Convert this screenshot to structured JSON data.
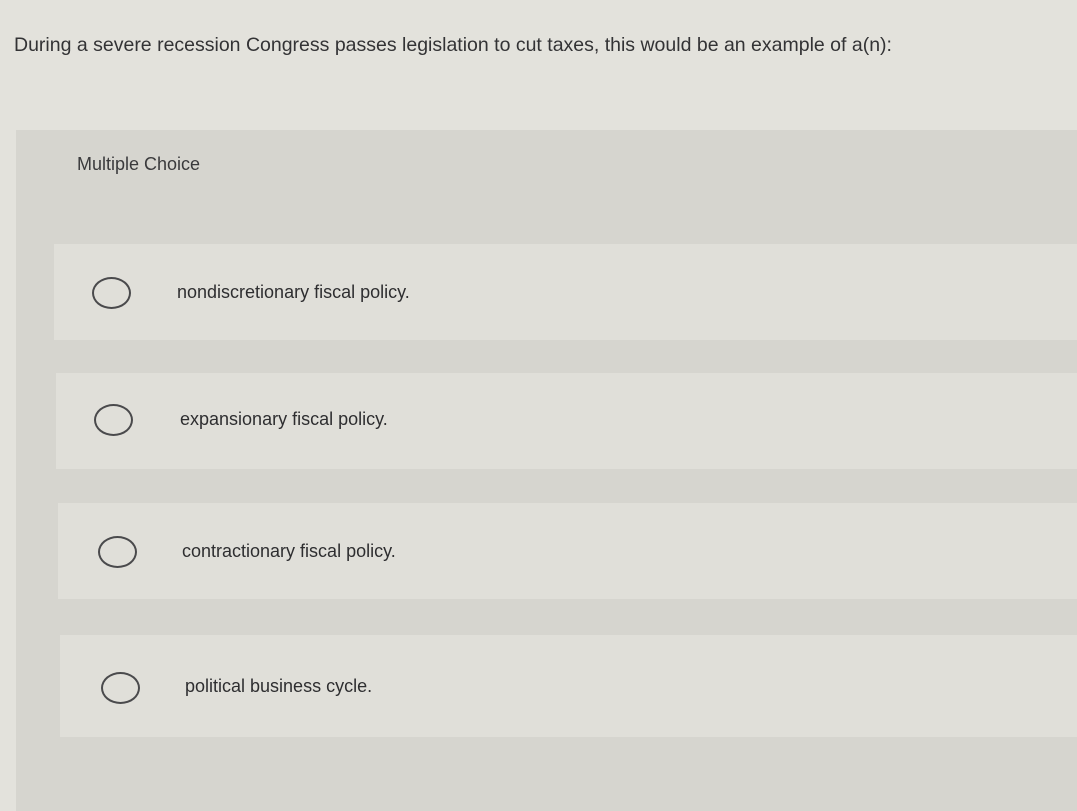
{
  "question": {
    "text": "During a severe recession Congress passes legislation to cut taxes, this would be an example of a(n):"
  },
  "section": {
    "label": "Multiple Choice"
  },
  "options": [
    {
      "label": "nondiscretionary fiscal policy.",
      "selected": false
    },
    {
      "label": "expansionary fiscal policy.",
      "selected": false
    },
    {
      "label": "contractionary fiscal policy.",
      "selected": false
    },
    {
      "label": "political business cycle.",
      "selected": false
    }
  ],
  "colors": {
    "page_background": "#e3e2dc",
    "panel_background": "#d6d5cf",
    "option_background": "#e0dfd9",
    "text": "#2f2f31"
  }
}
